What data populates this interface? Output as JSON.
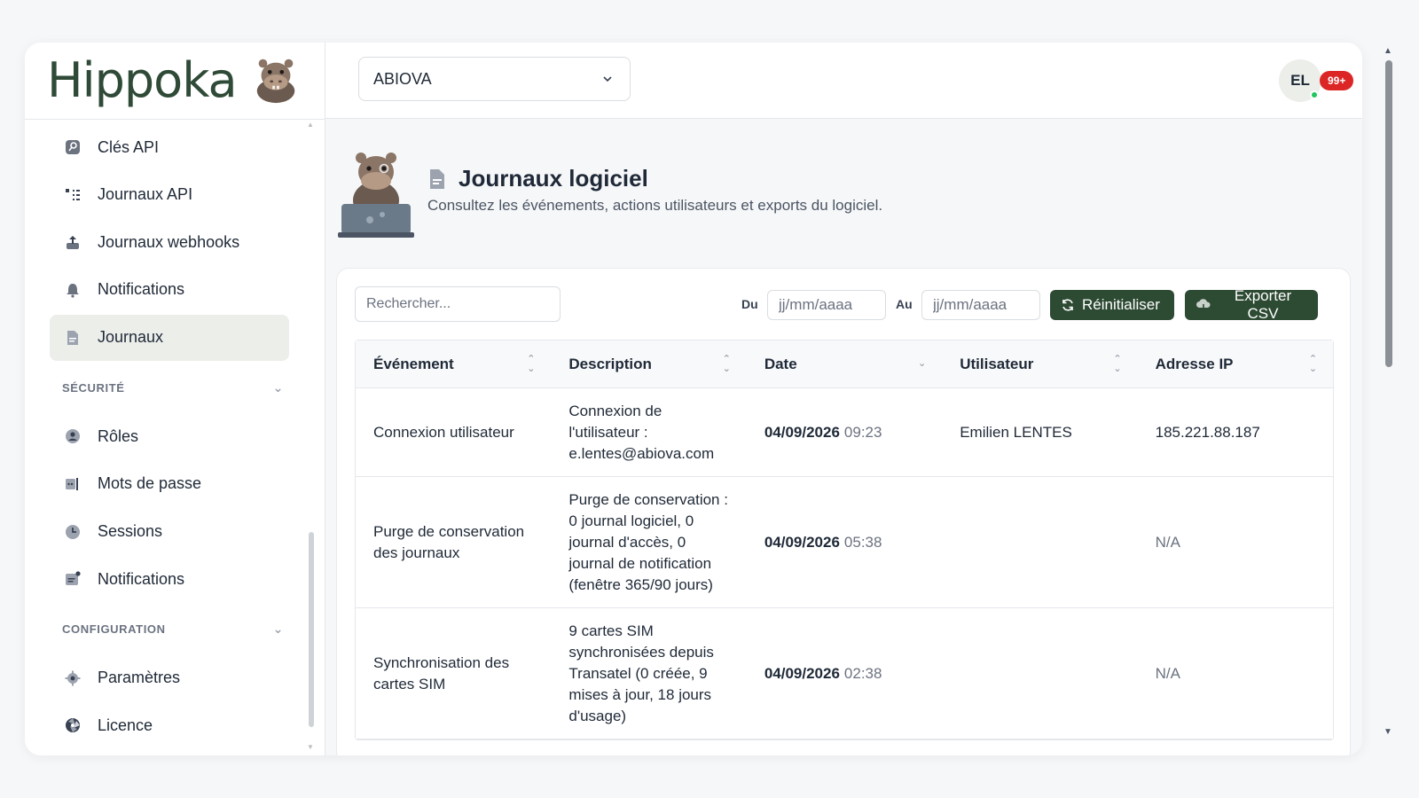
{
  "brand": {
    "name": "Hippoka"
  },
  "sidebar": {
    "items_top": [
      {
        "label": "Clés API",
        "icon": "key-icon"
      },
      {
        "label": "Journaux API",
        "icon": "list-tree-icon"
      },
      {
        "label": "Journaux webhooks",
        "icon": "upload-icon"
      },
      {
        "label": "Notifications",
        "icon": "bell-icon"
      },
      {
        "label": "Journaux",
        "icon": "document-icon",
        "active": true
      }
    ],
    "section_security": "SÉCURITÉ",
    "items_security": [
      {
        "label": "Rôles",
        "icon": "user-circle-icon"
      },
      {
        "label": "Mots de passe",
        "icon": "password-icon"
      },
      {
        "label": "Sessions",
        "icon": "clock-icon"
      },
      {
        "label": "Notifications",
        "icon": "notification-card-icon"
      }
    ],
    "section_config": "CONFIGURATION",
    "items_config": [
      {
        "label": "Paramètres",
        "icon": "gear-icon"
      },
      {
        "label": "Licence",
        "icon": "aperture-icon"
      }
    ]
  },
  "topbar": {
    "org_selected": "ABIOVA",
    "avatar_initials": "EL",
    "notification_count": "99+"
  },
  "page": {
    "title": "Journaux logiciel",
    "subtitle": "Consultez les événements, actions utilisateurs et exports du logiciel."
  },
  "filters": {
    "search_placeholder": "Rechercher...",
    "from_label": "Du",
    "to_label": "Au",
    "date_placeholder": "jj/mm/aaaa",
    "reset_label": "Réinitialiser",
    "export_label": "Exporter CSV"
  },
  "table": {
    "columns": [
      "Événement",
      "Description",
      "Date",
      "Utilisateur",
      "Adresse IP"
    ],
    "rows": [
      {
        "event": "Connexion utilisateur",
        "description": "Connexion de l'utilisateur : e.lentes@abiova.com",
        "date": "04/09/2026",
        "time": "09:23",
        "user": "Emilien LENTES",
        "ip": "185.221.88.187"
      },
      {
        "event": "Purge de conservation des journaux",
        "description": "Purge de conservation : 0 journal logiciel, 0 journal d'accès, 0 journal de notification (fenêtre 365/90 jours)",
        "date": "04/09/2026",
        "time": "05:38",
        "user": "",
        "ip": "N/A"
      },
      {
        "event": "Synchronisation des cartes SIM",
        "description": "9 cartes SIM synchronisées depuis Transatel (0 créée, 9 mises à jour, 18 jours d'usage)",
        "date": "04/09/2026",
        "time": "02:38",
        "user": "",
        "ip": "N/A"
      }
    ]
  },
  "colors": {
    "primary": "#2d4a33",
    "badge": "#dc2626",
    "online": "#22c55e",
    "active_nav": "#eceeea"
  }
}
